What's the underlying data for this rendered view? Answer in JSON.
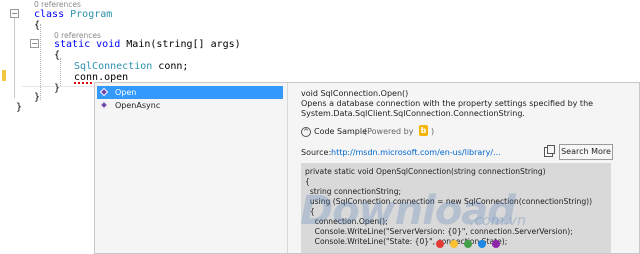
{
  "code": {
    "ref0": "0 references",
    "class_kw": "class",
    "class_name": "Program",
    "brace_open": "{",
    "ref1": "0 references",
    "static_kw": "static",
    "void_kw": "void",
    "main_sig": "Main(string[] args)",
    "inner_open": "{",
    "var_type": "SqlConnection",
    "var_decl": " conn;",
    "typed_text": "conn.open",
    "inner_close": "}",
    "class_close": "}",
    "ns_close": "}"
  },
  "completion": {
    "items": [
      {
        "label": "Open"
      },
      {
        "label": "OpenAsync"
      }
    ]
  },
  "tooltip": {
    "signature": "void SqlConnection.Open()",
    "description": "Opens a database connection with the property settings specified by the System.Data.SqlClient.SqlConnection.ConnectionString.",
    "code_sample_label": "Code Sample",
    "powered_by": "(Powered by",
    "powered_close": ")",
    "bing_glyph": "b",
    "source_label": "Source:",
    "source_url": "http://msdn.microsoft.com/en-us/library/...",
    "search_more": "Search More",
    "sample_lines": [
      "private static void OpenSqlConnection(string connectionString)",
      "{",
      "  string connectionString;",
      "  using (SqlConnection connection = new SqlConnection(connectionString))",
      "  {",
      "    connection.Open();",
      "    Console.WriteLine(\"ServerVersion: {0}\", connection.ServerVersion);",
      "    Console.WriteLine(\"State: {0}\", connection.State);"
    ]
  },
  "watermark": {
    "brand": "Download",
    "tld": ".com.vn"
  }
}
